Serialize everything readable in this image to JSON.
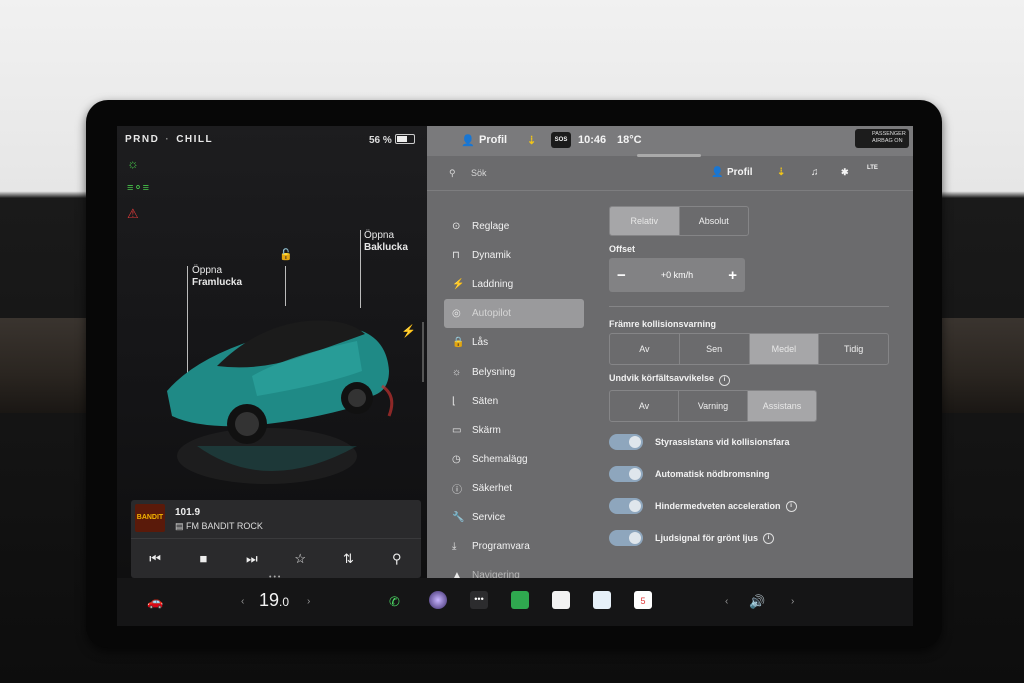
{
  "status": {
    "gears": "PRND",
    "drive_mode": "CHILL",
    "battery": "56 %"
  },
  "car_labels": {
    "front_trunk_1": "Öppna",
    "front_trunk_2": "Framlucka",
    "rear_trunk_1": "Öppna",
    "rear_trunk_2": "Baklucka"
  },
  "media": {
    "frequency": "101.9",
    "station": "FM BANDIT ROCK",
    "logo_text": "BANDIT"
  },
  "top_strip": {
    "profile": "Profil",
    "time": "10:46",
    "temperature": "18°C",
    "sos": "SOS",
    "airbag_1": "PASSENGER",
    "airbag_2": "AIRBAG ON"
  },
  "search_row": {
    "placeholder": "Sök",
    "profile": "Profil",
    "network": "LTE"
  },
  "menu": [
    {
      "label": "Reglage",
      "icon": "toggle-icon"
    },
    {
      "label": "Dynamik",
      "icon": "car-icon"
    },
    {
      "label": "Laddning",
      "icon": "bolt-icon"
    },
    {
      "label": "Autopilot",
      "icon": "steering-wheel-icon",
      "active": true
    },
    {
      "label": "Lås",
      "icon": "lock-icon"
    },
    {
      "label": "Belysning",
      "icon": "light-icon"
    },
    {
      "label": "Säten",
      "icon": "seat-icon"
    },
    {
      "label": "Skärm",
      "icon": "screen-icon"
    },
    {
      "label": "Schemalägg",
      "icon": "clock-icon"
    },
    {
      "label": "Säkerhet",
      "icon": "info-icon"
    },
    {
      "label": "Service",
      "icon": "wrench-icon"
    },
    {
      "label": "Programvara",
      "icon": "download-icon"
    },
    {
      "label": "Navigering",
      "icon": "navigation-icon",
      "faded": true
    }
  ],
  "autopilot": {
    "offset_mode": {
      "options": [
        "Relativ",
        "Absolut"
      ],
      "selected": "Relativ"
    },
    "offset": {
      "label": "Offset",
      "value": "+0 km/h",
      "minus": "−",
      "plus": "+"
    },
    "fcw": {
      "label": "Främre kollisionsvarning",
      "options": [
        "Av",
        "Sen",
        "Medel",
        "Tidig"
      ],
      "selected": "Medel"
    },
    "lane": {
      "label": "Undvik körfältsavvikelse",
      "options": [
        "Av",
        "Varning",
        "Assistans"
      ],
      "selected": "Assistans"
    },
    "toggles": [
      {
        "label": "Styrassistans vid kollisionsfara",
        "on": true,
        "info": false
      },
      {
        "label": "Automatisk nödbromsning",
        "on": true,
        "info": false
      },
      {
        "label": "Hindermedveten acceleration",
        "on": true,
        "info": true
      },
      {
        "label": "Ljudsignal för grönt ljus",
        "on": true,
        "info": true
      }
    ]
  },
  "taskbar": {
    "temperature_whole": "19",
    "temperature_decimal": ".0",
    "calendar_day": "5"
  },
  "colors": {
    "car_paint": "#1f8a86",
    "toggle_on": "#8ea6bd",
    "panel": "#6b6b6d",
    "warning_red": "#e03a3a",
    "indicator_green": "#46c44a",
    "download_yellow": "#f0c419"
  }
}
